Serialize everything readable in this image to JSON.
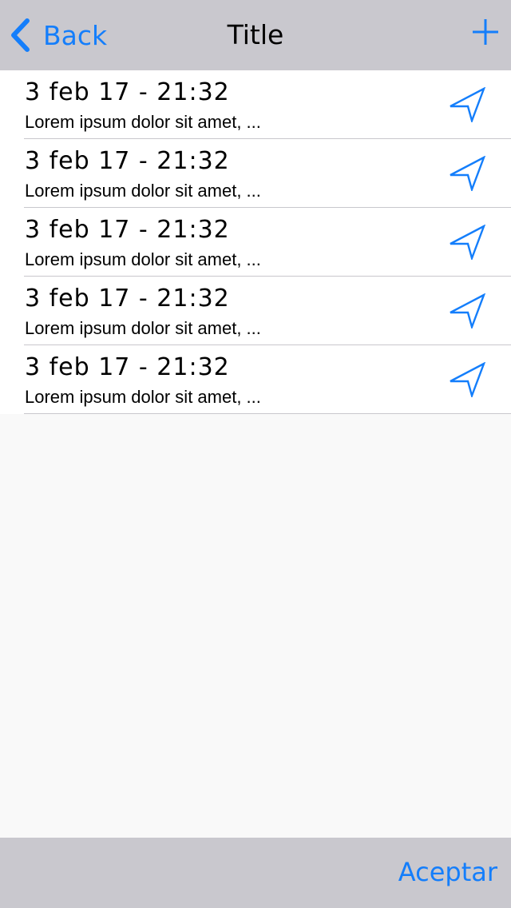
{
  "navbar": {
    "back_label": "Back",
    "title": "Title",
    "add_icon": "plus-icon",
    "back_icon": "chevron-left-icon"
  },
  "list": {
    "items": [
      {
        "time": "3 feb 17 - 21:32",
        "description": "Lorem ipsum dolor sit amet, ...",
        "icon": "location-arrow-icon"
      },
      {
        "time": "3 feb 17 - 21:32",
        "description": "Lorem ipsum dolor sit amet, ...",
        "icon": "location-arrow-icon"
      },
      {
        "time": "3 feb 17 - 21:32",
        "description": "Lorem ipsum dolor sit amet, ...",
        "icon": "location-arrow-icon"
      },
      {
        "time": "3 feb 17 - 21:32",
        "description": "Lorem ipsum dolor sit amet, ...",
        "icon": "location-arrow-icon"
      },
      {
        "time": "3 feb 17 - 21:32",
        "description": "Lorem ipsum dolor sit amet, ...",
        "icon": "location-arrow-icon"
      }
    ]
  },
  "toolbar": {
    "accept_label": "Aceptar"
  },
  "colors": {
    "tint": "#147efb",
    "bar_background": "#c9c8ce",
    "page_background": "#f9f9f9",
    "separator": "#c8c7cc"
  }
}
